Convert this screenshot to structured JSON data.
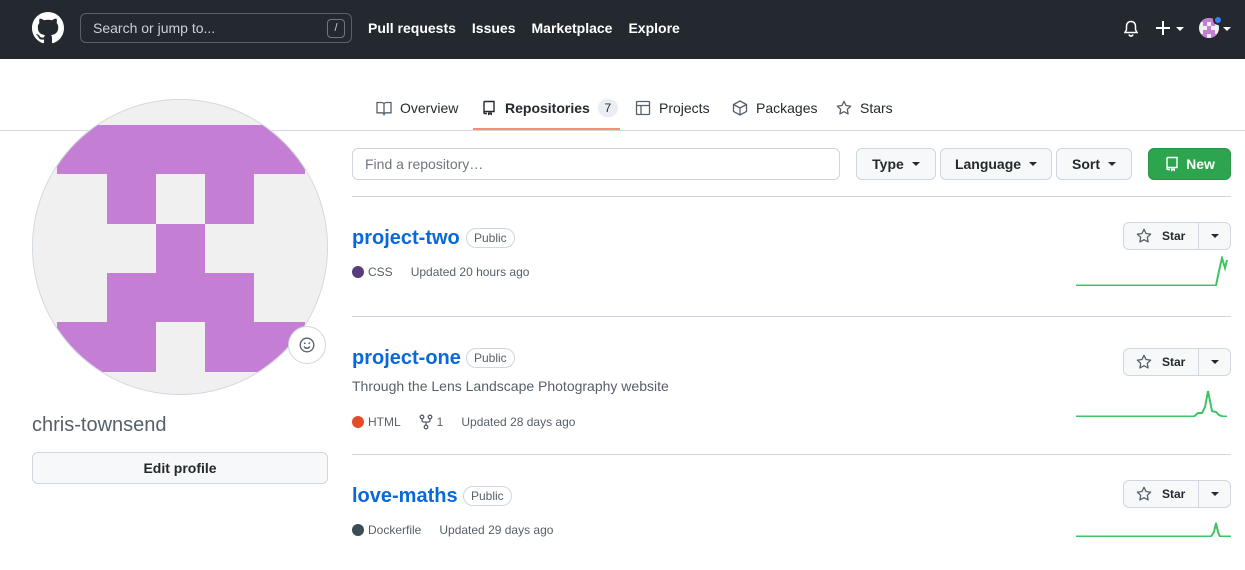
{
  "header": {
    "search_placeholder": "Search or jump to...",
    "search_shortcut": "/",
    "nav": [
      "Pull requests",
      "Issues",
      "Marketplace",
      "Explore"
    ]
  },
  "tabs": [
    {
      "label": "Overview",
      "icon": "book-icon"
    },
    {
      "label": "Repositories",
      "icon": "repo-icon",
      "count": "7",
      "active": true
    },
    {
      "label": "Projects",
      "icon": "table-icon"
    },
    {
      "label": "Packages",
      "icon": "package-icon"
    },
    {
      "label": "Stars",
      "icon": "star-icon"
    }
  ],
  "profile": {
    "username": "chris-townsend",
    "edit_label": "Edit profile",
    "avatar_color": "#c47fd5"
  },
  "filters": {
    "find_placeholder": "Find a repository…",
    "type_label": "Type",
    "language_label": "Language",
    "sort_label": "Sort",
    "new_label": "New"
  },
  "repos": [
    {
      "name": "project-two",
      "visibility": "Public",
      "description": "",
      "language": "CSS",
      "language_color": "#563d7c",
      "forks": "",
      "updated": "Updated 20 hours ago",
      "star_label": "Star"
    },
    {
      "name": "project-one",
      "visibility": "Public",
      "description": "Through the Lens Landscape Photography website",
      "language": "HTML",
      "language_color": "#e34c26",
      "forks": "1",
      "updated": "Updated 28 days ago",
      "star_label": "Star"
    },
    {
      "name": "love-maths",
      "visibility": "Public",
      "description": "",
      "language": "Dockerfile",
      "language_color": "#384d54",
      "forks": "",
      "updated": "Updated 29 days ago",
      "star_label": "Star"
    }
  ],
  "colors": {
    "header_bg": "#24292f",
    "link": "#0969da",
    "primary_button": "#2da44e",
    "tab_underline": "#fd8c73",
    "sparkline": "#40c463"
  }
}
